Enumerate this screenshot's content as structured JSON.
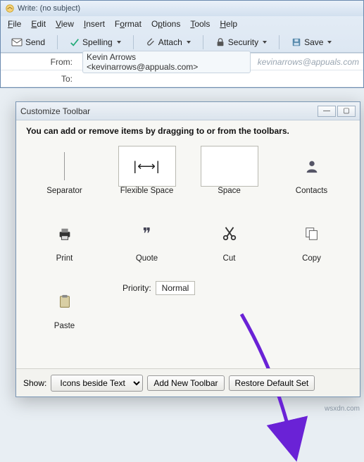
{
  "window": {
    "title": "Write: (no subject)"
  },
  "menubar": [
    "File",
    "Edit",
    "View",
    "Insert",
    "Format",
    "Options",
    "Tools",
    "Help"
  ],
  "toolbar": {
    "send": "Send",
    "spelling": "Spelling",
    "attach": "Attach",
    "security": "Security",
    "save": "Save"
  },
  "fields": {
    "from_label": "From:",
    "from_value": "Kevin Arrows <kevinarrows@appuals.com>",
    "from_hint": "kevinarrows@appuals.com",
    "to_label": "To:",
    "to_value": ""
  },
  "dialog": {
    "title": "Customize Toolbar",
    "intro": "You can add or remove items by dragging to or from the toolbars.",
    "items": [
      {
        "key": "separator",
        "label": "Separator"
      },
      {
        "key": "flexspace",
        "label": "Flexible Space"
      },
      {
        "key": "space",
        "label": "Space"
      },
      {
        "key": "contacts",
        "label": "Contacts"
      },
      {
        "key": "print",
        "label": "Print"
      },
      {
        "key": "quote",
        "label": "Quote"
      },
      {
        "key": "cut",
        "label": "Cut"
      },
      {
        "key": "copy",
        "label": "Copy"
      },
      {
        "key": "paste",
        "label": "Paste"
      }
    ],
    "priority_label": "Priority:",
    "priority_value": "Normal",
    "show_label": "Show:",
    "show_value": "Icons beside Text",
    "add_btn": "Add New Toolbar",
    "restore_btn": "Restore Default Set"
  },
  "watermark": "wsxdn.com"
}
